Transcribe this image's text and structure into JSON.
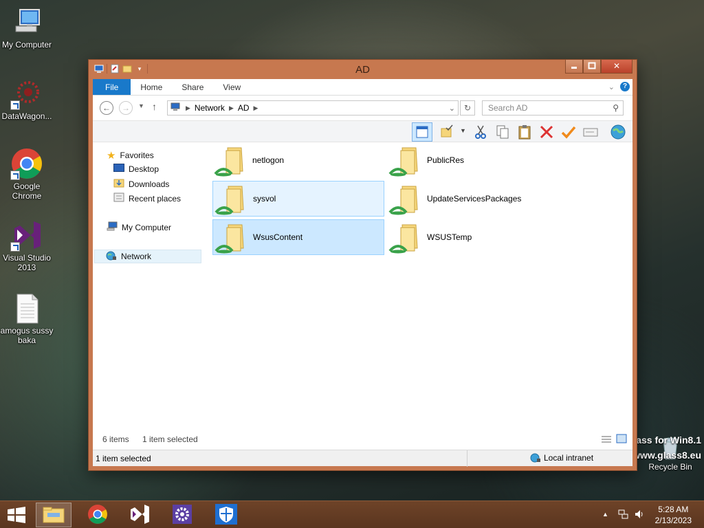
{
  "desktop": {
    "icons": [
      {
        "label": "My Computer"
      },
      {
        "label": "DataWagon..."
      },
      {
        "label": "Google Chrome"
      },
      {
        "label": "Visual Studio 2013"
      },
      {
        "label": "amogus sussy baka"
      },
      {
        "label": "Recycle Bin"
      }
    ],
    "watermark_line1": "ass for Win8.1",
    "watermark_line2": "www.glass8.eu"
  },
  "window": {
    "title": "AD",
    "ribbon_tabs": [
      "File",
      "Home",
      "Share",
      "View"
    ],
    "help_label": "?",
    "address": {
      "crumbs": [
        "Network",
        "AD"
      ]
    },
    "search": {
      "placeholder": "Search AD"
    },
    "nav": {
      "favorites": "Favorites",
      "desktop": "Desktop",
      "downloads": "Downloads",
      "recent": "Recent places",
      "my_computer": "My Computer",
      "network": "Network"
    },
    "items": [
      {
        "name": "netlogon",
        "state": "normal"
      },
      {
        "name": "PublicRes",
        "state": "normal"
      },
      {
        "name": "sysvol",
        "state": "hover"
      },
      {
        "name": "UpdateServicesPackages",
        "state": "normal"
      },
      {
        "name": "WsusContent",
        "state": "selected"
      },
      {
        "name": "WSUSTemp",
        "state": "normal"
      }
    ],
    "status": {
      "count": "6 items",
      "selection": "1 item selected",
      "bottom_selection": "1 item selected",
      "zone": "Local intranet"
    }
  },
  "taskbar": {
    "time": "5:28 AM",
    "date": "2/13/2023"
  },
  "colors": {
    "window_frame": "#c7784f",
    "file_tab": "#1979ca",
    "selection": "#cce8ff",
    "taskbar": "#6e4328"
  }
}
